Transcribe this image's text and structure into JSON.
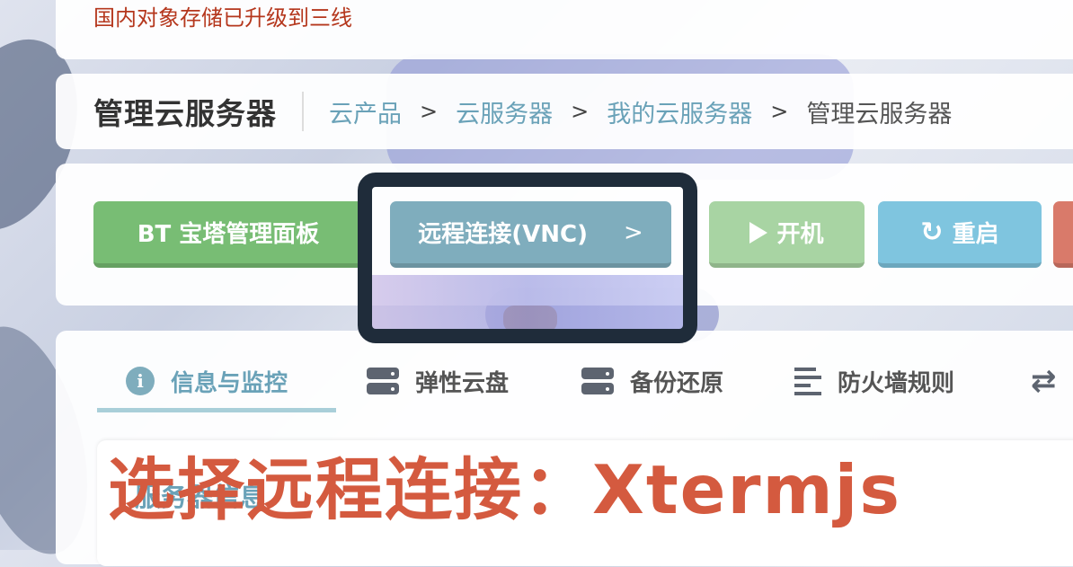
{
  "notice": {
    "text": "国内对象存储已升级到三线"
  },
  "header": {
    "title": "管理云服务器",
    "breadcrumb": [
      {
        "label": "云产品"
      },
      {
        "label": "云服务器"
      },
      {
        "label": "我的云服务器"
      },
      {
        "label": "管理云服务器"
      }
    ],
    "separator": ">"
  },
  "actions": {
    "bt_panel": "BT 宝塔管理面板",
    "vnc": "远程连接(VNC)",
    "vnc_chevron": ">",
    "start": "开机",
    "restart": "重启"
  },
  "tabs": [
    {
      "label": "信息与监控",
      "icon": "info-icon"
    },
    {
      "label": "弹性云盘",
      "icon": "drive-icon"
    },
    {
      "label": "备份还原",
      "icon": "drive-icon"
    },
    {
      "label": "防火墙规则",
      "icon": "lines-icon"
    },
    {
      "label": "",
      "icon": "swap-icon"
    }
  ],
  "section": {
    "title": "服务器信息"
  },
  "annotation": {
    "caption": "选择远程连接：Xtermjs"
  },
  "colors": {
    "accent": "#6aa2b8",
    "notice": "#b5371d",
    "green": "#78bd74",
    "caption": "#d45a3f",
    "highlight_border": "#1f2c3a"
  }
}
